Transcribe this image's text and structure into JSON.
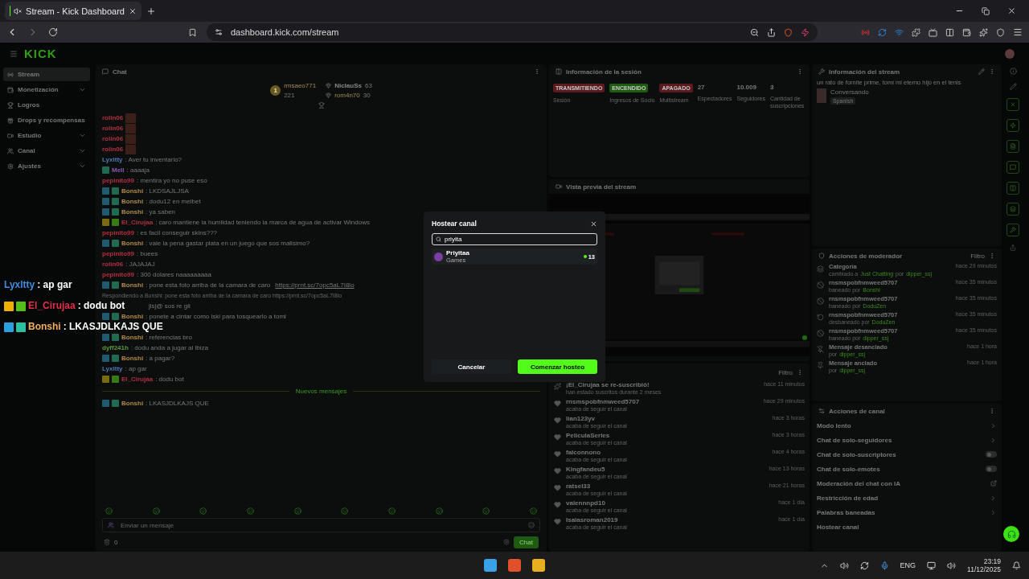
{
  "browser": {
    "tab_title": "Stream - Kick Dashboard",
    "url": "dashboard.kick.com/stream"
  },
  "header": {
    "logo": "KICK"
  },
  "sidebar": {
    "items": [
      {
        "label": "Stream",
        "kind": "radio",
        "selected": true,
        "expandable": false
      },
      {
        "label": "Monetización",
        "kind": "wallet",
        "selected": false,
        "expandable": true
      },
      {
        "label": "Logros",
        "kind": "trophy",
        "selected": false,
        "expandable": false
      },
      {
        "label": "Drops y recompensas",
        "kind": "gift",
        "selected": false,
        "expandable": false
      },
      {
        "label": "Estudio",
        "kind": "video",
        "selected": false,
        "expandable": true
      },
      {
        "label": "Canal",
        "kind": "users",
        "selected": false,
        "expandable": true
      },
      {
        "label": "Ajustes",
        "kind": "settings",
        "selected": false,
        "expandable": true
      }
    ]
  },
  "chat": {
    "title": "Chat",
    "leaderboard": [
      {
        "rank": "1",
        "name": "rmsaeo771",
        "count": "221"
      },
      {
        "name": "NiclauSs",
        "count": "63"
      },
      {
        "name": "rom4n70",
        "count": "30"
      }
    ],
    "messages": [
      {
        "kind": "emote",
        "user": "rolin06",
        "color": "#b03040"
      },
      {
        "kind": "emote",
        "user": "rolin06",
        "color": "#b03040"
      },
      {
        "kind": "emote",
        "user": "rolin06",
        "color": "#b03040"
      },
      {
        "kind": "emote",
        "user": "rolin06",
        "color": "#b03040"
      },
      {
        "kind": "text",
        "user": "Lyxltty",
        "color": "#4a7ab8",
        "text": ": Aver tu inventario?"
      },
      {
        "kind": "text",
        "user": "Mell",
        "color": "#8a5ab8",
        "text": ": aaaaja",
        "sub": true
      },
      {
        "kind": "text",
        "user": "pepinito99",
        "color": "#b03040",
        "text": ": mentira yo no puse eso"
      },
      {
        "kind": "text",
        "user": "Bonshi",
        "color": "#b08a4a",
        "text": ": LKDSAJLJSA",
        "mod": true,
        "sub": true
      },
      {
        "kind": "text",
        "user": "Bonshi",
        "color": "#b08a4a",
        "text": ": dodu12 en melbet",
        "mod": true,
        "sub": true
      },
      {
        "kind": "text",
        "user": "Bonshi",
        "color": "#b08a4a",
        "text": ": ya saben",
        "mod": true,
        "sub": true
      },
      {
        "kind": "text",
        "user": "El_Cirujaa",
        "color": "#b03040",
        "text": ": caro mantiene la humildad teniendo la marca de agua de activar Windows",
        "gift": true,
        "star": true
      },
      {
        "kind": "text",
        "user": "pepinito99",
        "color": "#b03040",
        "text": ": es facil conseguir skins???"
      },
      {
        "kind": "text",
        "user": "Bonshi",
        "color": "#b08a4a",
        "text": ": vale la pena gastar plata en un juego que sos malisimo?",
        "mod": true,
        "sub": true
      },
      {
        "kind": "text",
        "user": "pepinito99",
        "color": "#b03040",
        "text": ": buees"
      },
      {
        "kind": "text",
        "user": "rolin06",
        "color": "#b03040",
        "text": ": JAJAJAJ"
      },
      {
        "kind": "text",
        "user": "pepinito99",
        "color": "#b03040",
        "text": ": 300 dolares naaaaaaaaa"
      },
      {
        "kind": "text",
        "user": "Bonshi",
        "color": "#b08a4a",
        "text": ": pone esta foto arriba de la camara de caro",
        "link": "https://prnt.sc/7opc5aL7I8lo",
        "mod": true,
        "sub": true
      },
      {
        "kind": "reply",
        "text": "Respondiendo a Bonshi: pone esta foto arriba de la camara de caro https://prnt.sc/7opc5aL7I8lo"
      },
      {
        "kind": "partial",
        "text": "jisj@ sos re gil"
      },
      {
        "kind": "text",
        "user": "Bonshi",
        "color": "#b08a4a",
        "text": ": ponete a cintar como iski para tosquearlo a toml",
        "mod": true,
        "sub": true
      },
      {
        "kind": "covered"
      },
      {
        "kind": "text",
        "user": "Bonshi",
        "color": "#b08a4a",
        "text": ": referencias bro",
        "mod": true,
        "sub": true
      },
      {
        "kind": "text",
        "user": "dyff241h",
        "color": "#5a9a3a",
        "text": ": dodu anda a jugar al ibiza"
      },
      {
        "kind": "text",
        "user": "Bonshi",
        "color": "#b08a4a",
        "text": ": a pagar?",
        "mod": true,
        "sub": true
      },
      {
        "kind": "text",
        "user": "Lyxltty",
        "color": "#4a7ab8",
        "text": ": ap gar"
      },
      {
        "kind": "text",
        "user": "El_Cirujaa",
        "color": "#b03040",
        "text": ": dodu bot",
        "gift": true,
        "star": true
      },
      {
        "kind": "divider",
        "text": "Nuevos mensajes"
      },
      {
        "kind": "text",
        "user": "Bonshi",
        "color": "#b08a4a",
        "text": ": LKASJDLKAJS QUE",
        "mod": true,
        "sub": true
      }
    ],
    "input_placeholder": "Enviar un mensaje",
    "points": "0",
    "send": "Chat"
  },
  "overlay": [
    {
      "user": "Lyxltty",
      "color": "#3d8fe0",
      "text": ": ap gar"
    },
    {
      "user": "El_Cirujaa",
      "color": "#e0304a",
      "text": ": dodu bot",
      "star": true,
      "gift": true
    },
    {
      "user": "Bonshi",
      "color": "#f0b060",
      "text": ": LKASJDLKAJS QUE",
      "mod": true,
      "sub": true
    }
  ],
  "session": {
    "title": "Información de la sesión",
    "statuses": [
      {
        "value": "TRANSMITIENDO",
        "label": "Sesión",
        "color": "#5a1a1e"
      },
      {
        "value": "ENCENDIDO",
        "label": "Ingresos de Socio",
        "color": "#1f5a12"
      },
      {
        "value": "APAGADO",
        "label": "Multistream",
        "color": "#5a1a1e"
      }
    ],
    "stats": [
      {
        "value": "27",
        "label": "Espectadores"
      },
      {
        "value": "10.009",
        "label": "Seguidores"
      },
      {
        "value": "3",
        "label": "Cantidad de suscripciones"
      }
    ]
  },
  "preview": {
    "title": "Vista previa del stream",
    "kind": "picture"
  },
  "activity": {
    "filter": "Filtro",
    "items": [
      {
        "kind": "resub",
        "title": "¡El_Cirujaa se re-suscribió!",
        "detail": "han estado suscritos durante 2 meses",
        "time": "hace 11 minutos"
      },
      {
        "kind": "follow",
        "title": "rnsmspobfnmweed5707",
        "detail": "acaba de seguir el canal",
        "time": "hace 29 minutos"
      },
      {
        "kind": "follow",
        "title": "lian123yv",
        "detail": "acaba de seguir el canal",
        "time": "hace 3 horas"
      },
      {
        "kind": "follow",
        "title": "PeliculaSeries",
        "detail": "acaba de seguir el canal",
        "time": "hace 3 horas"
      },
      {
        "kind": "follow",
        "title": "falconnono",
        "detail": "acaba de seguir el canal",
        "time": "hace 4 horas"
      },
      {
        "kind": "follow",
        "title": "Kingfandeu5",
        "detail": "acaba de seguir el canal",
        "time": "hace 13 horas"
      },
      {
        "kind": "follow",
        "title": "ratsel33",
        "detail": "acaba de seguir el canal",
        "time": "hace 21 horas"
      },
      {
        "kind": "follow",
        "title": "valennnpd10",
        "detail": "acaba de seguir el canal",
        "time": "hace 1 día"
      },
      {
        "kind": "follow",
        "title": "Isaiasroman2019",
        "detail": "acaba de seguir el canal",
        "time": "hace 1 día"
      }
    ]
  },
  "stream_info": {
    "title": "Información del stream",
    "stream_title": "un rato de fornite prime, tomi mi eterno hijo en el tenis",
    "category": "Conversando",
    "tag": "Spanish"
  },
  "mod_actions": {
    "title": "Acciones de moderador",
    "filter": "Filtro",
    "items": [
      {
        "kind": "category",
        "title": "Categoría",
        "detail": "cambiado a",
        "target": "Just Chatting",
        "joiner": "por",
        "by": "dipper_ssj",
        "time": "hace 29 minutos"
      },
      {
        "kind": "ban",
        "title": "rnsmspobfnmweed5707",
        "detail": "baneado por",
        "by": "Bonshi",
        "time": "hace 35 minutos"
      },
      {
        "kind": "ban",
        "title": "rnsmspobfnmweed5707",
        "detail": "baneado por",
        "by": "DoduZen",
        "time": "hace 35 minutos"
      },
      {
        "kind": "unban",
        "title": "rnsmspobfnmweed5707",
        "detail": "desbaneado por",
        "by": "DoduZen",
        "time": "hace 35 minutos"
      },
      {
        "kind": "ban",
        "title": "rnsmspobfnmweed5707",
        "detail": "baneado por",
        "by": "dipper_ssj",
        "time": "hace 35 minutos"
      },
      {
        "kind": "unpin",
        "title": "Mensaje desanclado",
        "detail": "por",
        "by": "dipper_ssj",
        "time": "hace 1 hora"
      },
      {
        "kind": "pin",
        "title": "Mensaje anclado",
        "detail": "por",
        "by": "dipper_ssj",
        "time": "hace 1 hora"
      }
    ]
  },
  "channel_actions": {
    "title": "Acciones de canal",
    "items": [
      {
        "kind": "chevron",
        "label": "Modo lento"
      },
      {
        "kind": "chevron",
        "label": "Chat de solo-seguidores"
      },
      {
        "kind": "toggle",
        "label": "Chat de solo-suscriptores",
        "on": false
      },
      {
        "kind": "toggle",
        "label": "Chat de solo-emotes",
        "on": false
      },
      {
        "kind": "external",
        "label": "Moderación del chat con IA"
      },
      {
        "kind": "chevron",
        "label": "Restricción de edad"
      },
      {
        "kind": "chevron",
        "label": "Palabras baneadas"
      },
      {
        "kind": "plain",
        "label": "Hostear canal"
      }
    ]
  },
  "modal": {
    "title": "Hostear canal",
    "search_value": "priyita",
    "results": [
      {
        "name": "Priyitaa",
        "category": "Games",
        "viewers": "13",
        "live": true
      }
    ],
    "cancel": "Cancelar",
    "confirm": "Comenzar hosteo"
  },
  "taskbar": {
    "language": "ENG",
    "time": "23:19",
    "date": "11/12/2025"
  }
}
